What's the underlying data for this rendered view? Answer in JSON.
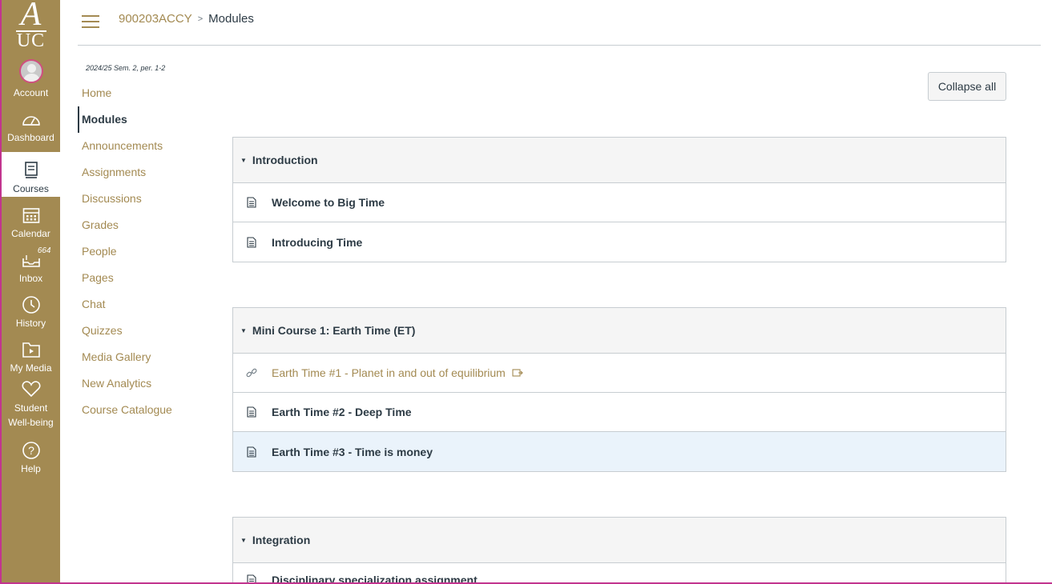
{
  "global_nav": {
    "logo": {
      "top": "A",
      "bottom": "UC"
    },
    "items": [
      {
        "label": "Account",
        "icon": "avatar-icon"
      },
      {
        "label": "Dashboard",
        "icon": "dashboard-icon"
      },
      {
        "label": "Courses",
        "icon": "courses-icon",
        "active": true
      },
      {
        "label": "Calendar",
        "icon": "calendar-icon"
      },
      {
        "label": "Inbox",
        "icon": "inbox-icon",
        "badge": "664"
      },
      {
        "label": "History",
        "icon": "history-icon"
      },
      {
        "label": "My Media",
        "icon": "my-media-icon"
      },
      {
        "label": "Student Well-being",
        "label_line1": "Student",
        "label_line2": "Well-being",
        "icon": "heart-icon"
      },
      {
        "label": "Help",
        "icon": "help-icon"
      }
    ],
    "colors": {
      "background": "#a38a52",
      "text": "#ffffff"
    }
  },
  "header": {
    "breadcrumb": {
      "course": "900203ACCY",
      "separator": ">",
      "current": "Modules"
    }
  },
  "course_nav": {
    "term": "2024/25 Sem. 2, per. 1-2",
    "items": [
      "Home",
      "Modules",
      "Announcements",
      "Assignments",
      "Discussions",
      "Grades",
      "People",
      "Pages",
      "Chat",
      "Quizzes",
      "Media Gallery",
      "New Analytics",
      "Course Catalogue"
    ],
    "active": "Modules"
  },
  "toolbar": {
    "collapse_label": "Collapse all"
  },
  "modules": [
    {
      "title": "Introduction",
      "items": [
        {
          "title": "Welcome to Big Time",
          "type": "page"
        },
        {
          "title": "Introducing Time",
          "type": "page"
        }
      ]
    },
    {
      "title": "Mini Course 1: Earth Time (ET)",
      "items": [
        {
          "title": "Earth Time #1 - Planet in and out of equilibrium",
          "type": "external-link"
        },
        {
          "title": "Earth Time #2 - Deep Time",
          "type": "page"
        },
        {
          "title": "Earth Time #3 - Time is money",
          "type": "page",
          "highlighted": true
        }
      ]
    },
    {
      "title": "Integration",
      "items": [
        {
          "title": "Disciplinary specialization assignment",
          "type": "page"
        }
      ]
    }
  ],
  "colors": {
    "accent": "#a38a52",
    "text": "#2d3b45",
    "border": "#c7cdd1",
    "highlight": "#eaf3fb"
  }
}
